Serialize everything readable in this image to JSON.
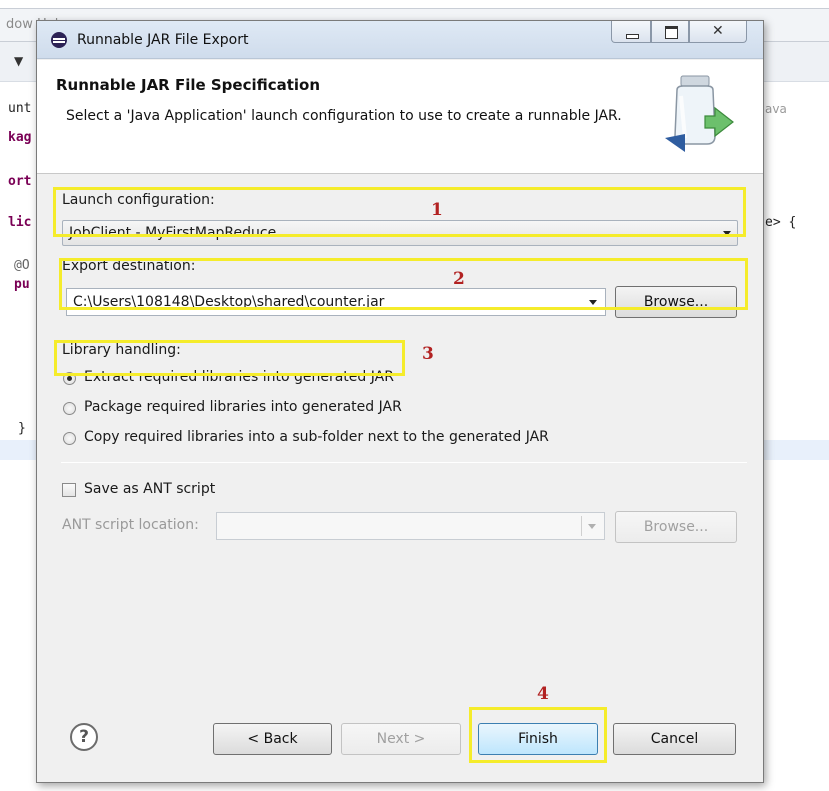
{
  "background": {
    "window_title_fragment": "dow  Hel",
    "code_lines": [
      "unt",
      "kag",
      "ort",
      "lic",
      "@O",
      "pu",
      "}"
    ],
    "right_fragment_1": "ava",
    "right_fragment_2": "e> {"
  },
  "dialog": {
    "title": "Runnable JAR File Export",
    "close_glyph": "✕",
    "header": {
      "title": "Runnable JAR File Specification",
      "description": "Select a 'Java Application' launch configuration to use to create a runnable JAR."
    },
    "launch": {
      "label": "Launch configuration:",
      "value": "JobClient - MyFirstMapReduce"
    },
    "export": {
      "label": "Export destination:",
      "value": "C:\\Users\\108148\\Desktop\\shared\\counter.jar",
      "browse": "Browse..."
    },
    "library": {
      "label": "Library handling:",
      "options": [
        {
          "label": "Extract required libraries into generated JAR",
          "checked": true
        },
        {
          "label": "Package required libraries into generated JAR",
          "checked": false
        },
        {
          "label": "Copy required libraries into a sub-folder next to the generated JAR",
          "checked": false
        }
      ]
    },
    "ant": {
      "checkbox_label": "Save as ANT script",
      "checked": false,
      "location_label": "ANT script location:",
      "location_value": "",
      "browse": "Browse..."
    },
    "footer": {
      "help": "?",
      "back": "< Back",
      "next": "Next >",
      "finish": "Finish",
      "cancel": "Cancel"
    }
  },
  "annotations": {
    "numbers": [
      "1",
      "2",
      "3",
      "4"
    ],
    "highlight_color": "#f5ec2b",
    "number_color": "#b22222"
  }
}
